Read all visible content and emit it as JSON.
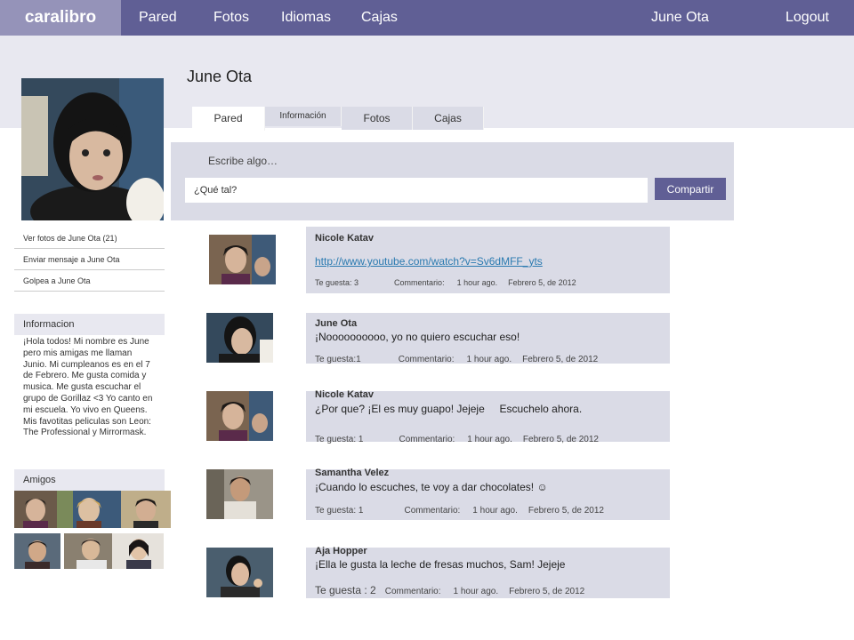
{
  "app": {
    "logo": "caralibro"
  },
  "nav": {
    "items": [
      "Pared",
      "Fotos",
      "Idiomas",
      "Cajas"
    ],
    "user": "June Ota",
    "logout": "Logout"
  },
  "profile": {
    "name": "June Ota",
    "links": [
      "Ver fotos de June Ota (21)",
      "Enviar mensaje a June Ota",
      "Golpea a June Ota"
    ],
    "info_header": "Informacion",
    "info_text": "¡Hola todos! Mi nombre es June pero mis amigas me llaman Junio. Mi cumpleanos es en el 7 de Febrero. Me gusta comida y musica. Me gusta escuchar el grupo de Gorillaz <3 Yo canto en mi escuela. Yo vivo en Queens. Mis favotitas peliculas son Leon: The Professional y Mirrormask.",
    "friends_header": "Amigos"
  },
  "tabs": [
    "Pared",
    "Información",
    "Fotos",
    "Cajas"
  ],
  "composer": {
    "label": "Escribe algo…",
    "input_value": "¿Qué tal?",
    "share": "Compartir"
  },
  "posts": [
    {
      "author": "Nicole Katav",
      "link": "http://www.youtube.com/watch?v=Sv6dMFF_yts",
      "likes": "Te guesta: 3",
      "comment": "Commentario:",
      "time": "1 hour ago.",
      "date": "Febrero 5, de 2012"
    },
    {
      "author": "June Ota",
      "body": "¡Noooooooooo, yo no quiero escuchar eso!",
      "likes": "Te guesta:1",
      "comment": "Commentario:",
      "time": "1 hour ago.",
      "date": "Febrero 5, de 2012"
    },
    {
      "author": "Nicole Katav",
      "body": "¿Por que? ¡El es muy guapo! Jejeje     Escuchelo ahora.",
      "likes": "Te guesta:  1",
      "comment": "Commentario:",
      "time": "1 hour ago.",
      "date": "Febrero 5, de 2012"
    },
    {
      "author": "Samantha Velez",
      "body": "¡Cuando lo escuches, te voy a dar chocolates! ☺",
      "likes": "Te guesta:  1",
      "comment": "Commentario:",
      "time": "1 hour ago.",
      "date": "Febrero 5, de 2012"
    },
    {
      "author": "Aja Hopper",
      "body": "¡Ella le gusta la leche de fresas muchos, Sam! Jejeje",
      "likes": "Te guesta : 2",
      "comment": "Commentario:",
      "time": "1 hour ago.",
      "date": "Febrero 5, de 2012"
    }
  ],
  "colors": {
    "nav": "#605f95",
    "logo_bg": "#9593b9",
    "panel": "#dadbe6",
    "band": "#e8e8f0"
  }
}
